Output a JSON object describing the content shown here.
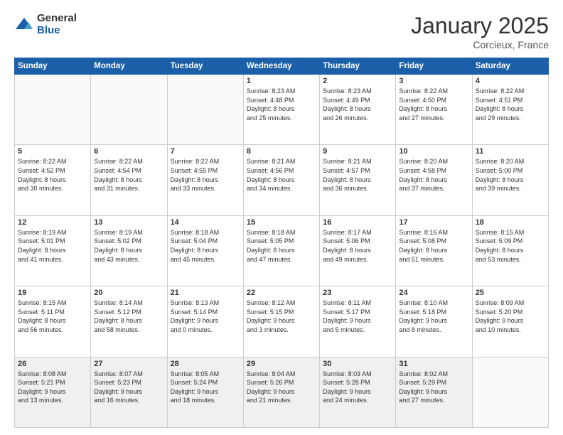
{
  "logo": {
    "general": "General",
    "blue": "Blue"
  },
  "header": {
    "month": "January 2025",
    "location": "Corcieux, France"
  },
  "weekdays": [
    "Sunday",
    "Monday",
    "Tuesday",
    "Wednesday",
    "Thursday",
    "Friday",
    "Saturday"
  ],
  "weeks": [
    [
      {
        "day": "",
        "info": ""
      },
      {
        "day": "",
        "info": ""
      },
      {
        "day": "",
        "info": ""
      },
      {
        "day": "1",
        "info": "Sunrise: 8:23 AM\nSunset: 4:48 PM\nDaylight: 8 hours\nand 25 minutes."
      },
      {
        "day": "2",
        "info": "Sunrise: 8:23 AM\nSunset: 4:49 PM\nDaylight: 8 hours\nand 26 minutes."
      },
      {
        "day": "3",
        "info": "Sunrise: 8:22 AM\nSunset: 4:50 PM\nDaylight: 8 hours\nand 27 minutes."
      },
      {
        "day": "4",
        "info": "Sunrise: 8:22 AM\nSunset: 4:51 PM\nDaylight: 8 hours\nand 29 minutes."
      }
    ],
    [
      {
        "day": "5",
        "info": "Sunrise: 8:22 AM\nSunset: 4:52 PM\nDaylight: 8 hours\nand 30 minutes."
      },
      {
        "day": "6",
        "info": "Sunrise: 8:22 AM\nSunset: 4:54 PM\nDaylight: 8 hours\nand 31 minutes."
      },
      {
        "day": "7",
        "info": "Sunrise: 8:22 AM\nSunset: 4:55 PM\nDaylight: 8 hours\nand 33 minutes."
      },
      {
        "day": "8",
        "info": "Sunrise: 8:21 AM\nSunset: 4:56 PM\nDaylight: 8 hours\nand 34 minutes."
      },
      {
        "day": "9",
        "info": "Sunrise: 8:21 AM\nSunset: 4:57 PM\nDaylight: 8 hours\nand 36 minutes."
      },
      {
        "day": "10",
        "info": "Sunrise: 8:20 AM\nSunset: 4:58 PM\nDaylight: 8 hours\nand 37 minutes."
      },
      {
        "day": "11",
        "info": "Sunrise: 8:20 AM\nSunset: 5:00 PM\nDaylight: 8 hours\nand 39 minutes."
      }
    ],
    [
      {
        "day": "12",
        "info": "Sunrise: 8:19 AM\nSunset: 5:01 PM\nDaylight: 8 hours\nand 41 minutes."
      },
      {
        "day": "13",
        "info": "Sunrise: 8:19 AM\nSunset: 5:02 PM\nDaylight: 8 hours\nand 43 minutes."
      },
      {
        "day": "14",
        "info": "Sunrise: 8:18 AM\nSunset: 5:04 PM\nDaylight: 8 hours\nand 45 minutes."
      },
      {
        "day": "15",
        "info": "Sunrise: 8:18 AM\nSunset: 5:05 PM\nDaylight: 8 hours\nand 47 minutes."
      },
      {
        "day": "16",
        "info": "Sunrise: 8:17 AM\nSunset: 5:06 PM\nDaylight: 8 hours\nand 49 minutes."
      },
      {
        "day": "17",
        "info": "Sunrise: 8:16 AM\nSunset: 5:08 PM\nDaylight: 8 hours\nand 51 minutes."
      },
      {
        "day": "18",
        "info": "Sunrise: 8:15 AM\nSunset: 5:09 PM\nDaylight: 8 hours\nand 53 minutes."
      }
    ],
    [
      {
        "day": "19",
        "info": "Sunrise: 8:15 AM\nSunset: 5:11 PM\nDaylight: 8 hours\nand 56 minutes."
      },
      {
        "day": "20",
        "info": "Sunrise: 8:14 AM\nSunset: 5:12 PM\nDaylight: 8 hours\nand 58 minutes."
      },
      {
        "day": "21",
        "info": "Sunrise: 8:13 AM\nSunset: 5:14 PM\nDaylight: 9 hours\nand 0 minutes."
      },
      {
        "day": "22",
        "info": "Sunrise: 8:12 AM\nSunset: 5:15 PM\nDaylight: 9 hours\nand 3 minutes."
      },
      {
        "day": "23",
        "info": "Sunrise: 8:11 AM\nSunset: 5:17 PM\nDaylight: 9 hours\nand 5 minutes."
      },
      {
        "day": "24",
        "info": "Sunrise: 8:10 AM\nSunset: 5:18 PM\nDaylight: 9 hours\nand 8 minutes."
      },
      {
        "day": "25",
        "info": "Sunrise: 8:09 AM\nSunset: 5:20 PM\nDaylight: 9 hours\nand 10 minutes."
      }
    ],
    [
      {
        "day": "26",
        "info": "Sunrise: 8:08 AM\nSunset: 5:21 PM\nDaylight: 9 hours\nand 13 minutes."
      },
      {
        "day": "27",
        "info": "Sunrise: 8:07 AM\nSunset: 5:23 PM\nDaylight: 9 hours\nand 16 minutes."
      },
      {
        "day": "28",
        "info": "Sunrise: 8:05 AM\nSunset: 5:24 PM\nDaylight: 9 hours\nand 18 minutes."
      },
      {
        "day": "29",
        "info": "Sunrise: 8:04 AM\nSunset: 5:26 PM\nDaylight: 9 hours\nand 21 minutes."
      },
      {
        "day": "30",
        "info": "Sunrise: 8:03 AM\nSunset: 5:28 PM\nDaylight: 9 hours\nand 24 minutes."
      },
      {
        "day": "31",
        "info": "Sunrise: 8:02 AM\nSunset: 5:29 PM\nDaylight: 9 hours\nand 27 minutes."
      },
      {
        "day": "",
        "info": ""
      }
    ]
  ]
}
